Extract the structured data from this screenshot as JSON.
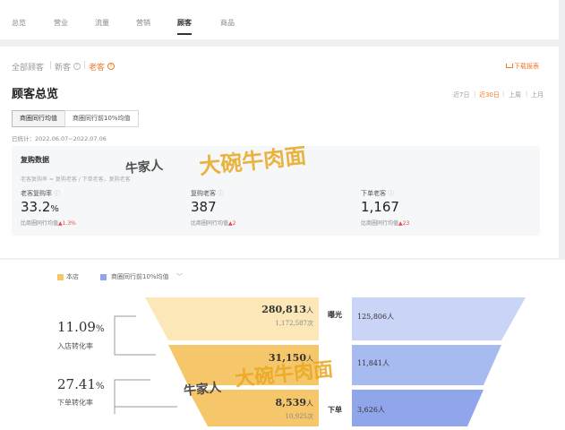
{
  "nav": {
    "items": [
      "总览",
      "营业",
      "流量",
      "营销",
      "顾客",
      "商品"
    ],
    "active_index": 4
  },
  "filters": {
    "all": "全部顾客",
    "new": "新客",
    "old": "老客",
    "download": "下载报表"
  },
  "overview": {
    "title": "顾客总览",
    "periods": [
      "近7日",
      "近30日",
      "上周",
      "上月"
    ],
    "active_period_index": 1,
    "tabs": [
      "商圈同行均值",
      "商圈同行前10%均值"
    ],
    "active_tab_index": 0,
    "stat_time": "已统计：2022.06.07~2022.07.06"
  },
  "repurchase": {
    "title": "复购数据",
    "desc": "老客复购率 = 复购老客 / 下单老客，复购老客",
    "metrics": [
      {
        "label": "老客复购率",
        "value": "33.2",
        "unit": "%",
        "compare": "比商圈同行均值",
        "delta": "1.3%"
      },
      {
        "label": "复购老客",
        "value": "387",
        "unit": "",
        "compare": "比商圈同行均值",
        "delta": "2"
      },
      {
        "label": "下单老客",
        "value": "1,167",
        "unit": "",
        "compare": "比商圈同行均值",
        "delta": "23"
      }
    ]
  },
  "funnel": {
    "legend": {
      "store": "本店",
      "peer": "商圈同行前10%均值"
    },
    "colors": {
      "store": "#f6c66a",
      "store_light": "#fbe7b8",
      "peer": "#8fa6ea",
      "peer_light": "#c9d4f7",
      "accent": "#f07a2b"
    },
    "rates": [
      {
        "value": "11.09",
        "unit": "%",
        "label": "入店转化率"
      },
      {
        "value": "27.41",
        "unit": "%",
        "label": "下单转化率"
      }
    ],
    "stages": [
      {
        "stage": "曝光",
        "store_main": "280,813",
        "store_main_unit": "人",
        "store_sub": "1,172,587次",
        "peer": "125,806",
        "peer_unit": "人"
      },
      {
        "stage": "",
        "store_main": "31,150",
        "store_main_unit": "人",
        "store_sub": "",
        "peer": "11,841",
        "peer_unit": "人"
      },
      {
        "stage": "下单",
        "store_main": "8,539",
        "store_main_unit": "人",
        "store_sub": "10,925次",
        "peer": "3,626",
        "peer_unit": "人"
      }
    ]
  },
  "watermark": {
    "brand": "牛家人",
    "text": "大碗牛肉面"
  }
}
